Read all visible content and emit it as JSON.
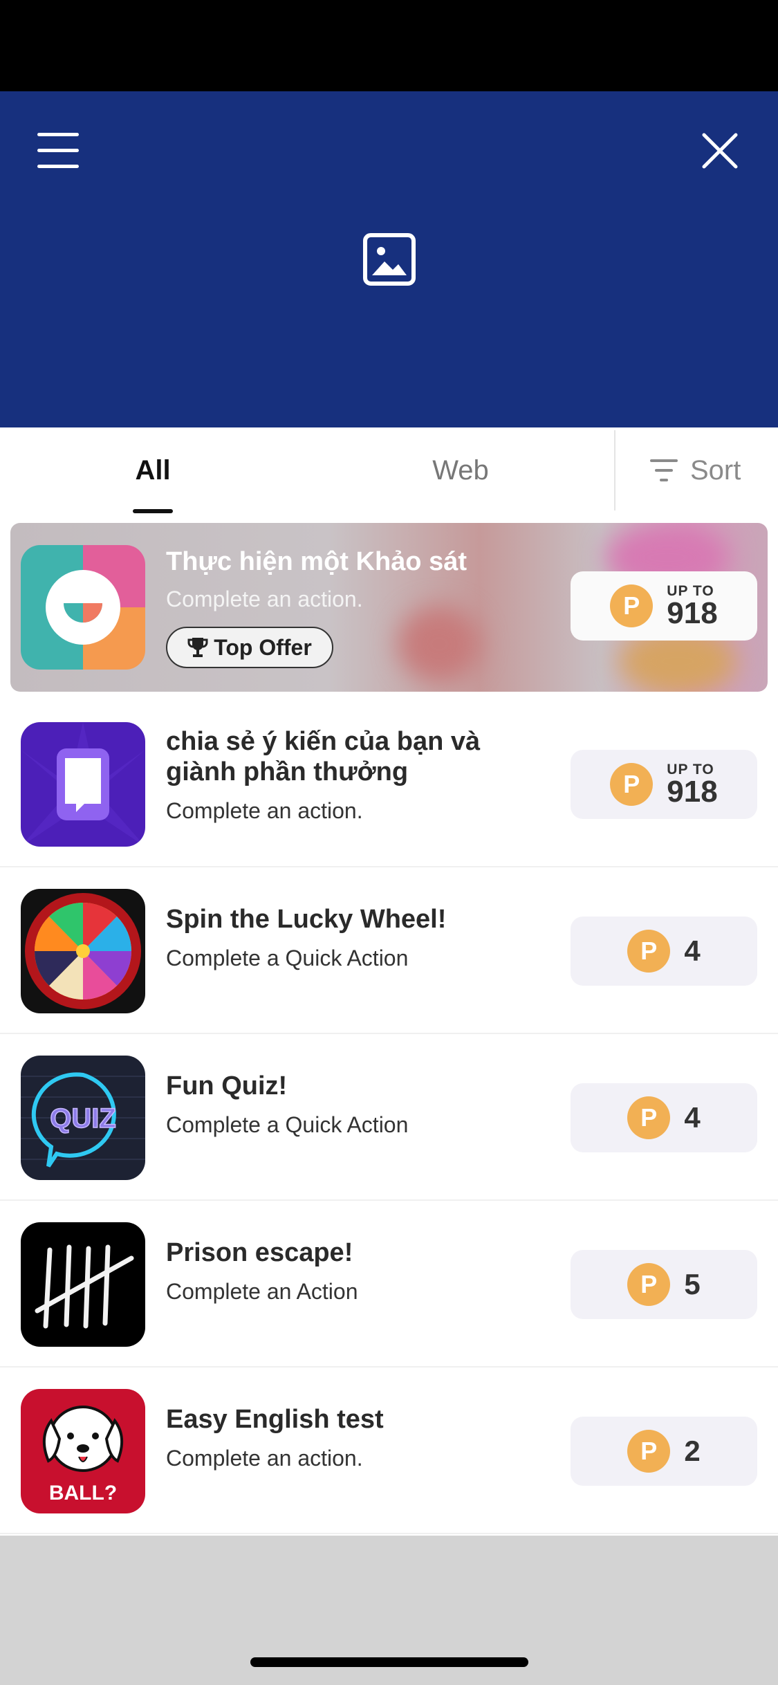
{
  "header": {
    "menu_icon": "hamburger-menu-icon",
    "close_icon": "close-icon",
    "banner_icon": "image-placeholder-icon",
    "background_color": "#17307e"
  },
  "tabs": [
    {
      "label": "All",
      "active": true
    },
    {
      "label": "Web",
      "active": false
    }
  ],
  "sort": {
    "label": "Sort",
    "icon": "sort-filter-icon"
  },
  "offers": [
    {
      "title": "Thực hiện một Khảo sát",
      "subtitle": "Complete an action.",
      "badge": "Top Offer",
      "reward_label": "UP TO",
      "reward": "918",
      "coin": "P",
      "featured": true
    },
    {
      "title": "chia sẻ ý kiến của bạn và giành phần thưởng",
      "subtitle": "Complete an action.",
      "reward_label": "UP TO",
      "reward": "918",
      "coin": "P"
    },
    {
      "title": "Spin the Lucky Wheel!",
      "subtitle": "Complete a Quick Action",
      "reward": "4",
      "coin": "P"
    },
    {
      "title": "Fun Quiz!",
      "subtitle": "Complete a Quick Action",
      "reward": "4",
      "coin": "P",
      "icon_text": "QUIZ"
    },
    {
      "title": "Prison escape!",
      "subtitle": "Complete an Action",
      "reward": "5",
      "coin": "P"
    },
    {
      "title": "Easy English test",
      "subtitle": "Complete an action.",
      "reward": "2",
      "coin": "P",
      "icon_text": "BALL?"
    }
  ],
  "colors": {
    "coin": "#f2b054",
    "reward_bg": "#f2f1f7",
    "accent": "#17307e"
  }
}
